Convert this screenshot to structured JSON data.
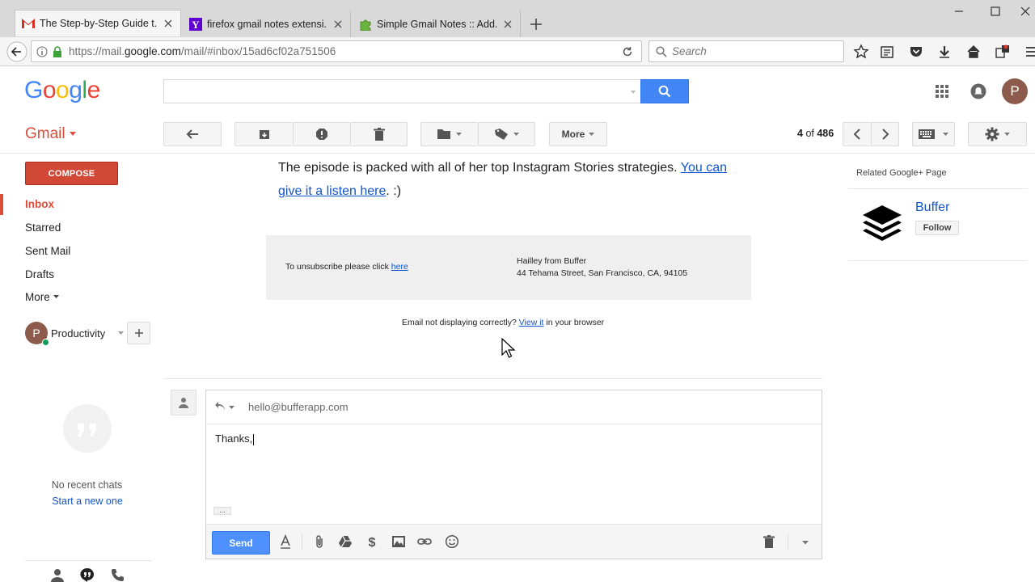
{
  "browser": {
    "tabs": [
      {
        "title": "The Step-by-Step Guide t...",
        "icon": "gmail-icon",
        "active": true
      },
      {
        "title": "firefox gmail notes extensi...",
        "icon": "yahoo-icon",
        "active": false
      },
      {
        "title": "Simple Gmail Notes :: Add...",
        "icon": "puzzle-icon",
        "active": false
      }
    ],
    "url_prefix": "https://mail.",
    "url_host": "google.com",
    "url_path": "/mail/#inbox/15ad6cf02a751506",
    "search_placeholder": "Search"
  },
  "gmail": {
    "logo_letters": [
      "G",
      "o",
      "o",
      "g",
      "l",
      "e"
    ],
    "app_label": "Gmail",
    "account_initial": "P",
    "toolbar": {
      "more_label": "More",
      "pager_position": "4",
      "pager_of": "of",
      "pager_total": "486"
    },
    "compose_label": "COMPOSE",
    "nav": {
      "inbox": "Inbox",
      "starred": "Starred",
      "sent": "Sent Mail",
      "drafts": "Drafts",
      "more": "More"
    },
    "hangouts": {
      "user_initial": "P",
      "user_name": "Productivity",
      "no_chats": "No recent chats",
      "start_new": "Start a new one"
    },
    "email": {
      "para_text": "The episode is packed with all of her top Instagram Stories strategies. ",
      "para_link": "You can give it a listen here",
      "para_end": ". :)",
      "unsubscribe_text": "To unsubscribe please click ",
      "unsubscribe_link": "here",
      "sender_name": "Hailley from Buffer",
      "sender_address": "44 Tehama Street, San Francisco, CA, 94105",
      "display_text": "Email not displaying correctly? ",
      "display_link": "View it",
      "display_end": " in your browser"
    },
    "reply": {
      "to": "hello@bufferapp.com",
      "body": "Thanks,",
      "send_label": "Send",
      "ellipsis": "..."
    },
    "related": {
      "title": "Related Google+ Page",
      "page_name": "Buffer",
      "follow_label": "Follow"
    }
  },
  "colors": {
    "gmail_red": "#dd4b39",
    "compose_red": "#d14836",
    "google_blue": "#4285f4",
    "link_blue": "#1155cc"
  }
}
